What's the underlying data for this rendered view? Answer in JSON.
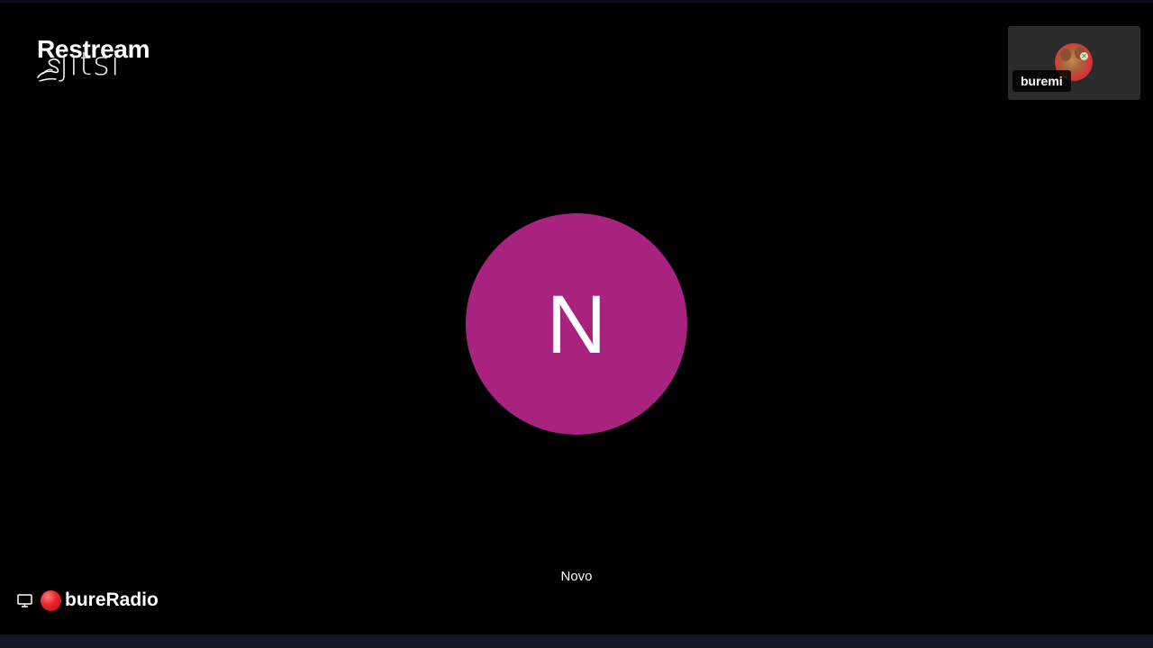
{
  "overlay": {
    "brand_label": "Restream",
    "logo_text": "jitsi"
  },
  "main_participant": {
    "initial": "N",
    "name": "Novo",
    "avatar_color": "#a82380"
  },
  "thumbnail": {
    "name": "buremi",
    "background_color": "#2b2b2b"
  },
  "footer": {
    "room_name": "bureRadio",
    "record_dot_color": "#e8232b"
  },
  "icons": [
    "jitsi-logo-icon",
    "screen-share-icon",
    "recording-dot-icon",
    "participant-avatar-icon"
  ]
}
